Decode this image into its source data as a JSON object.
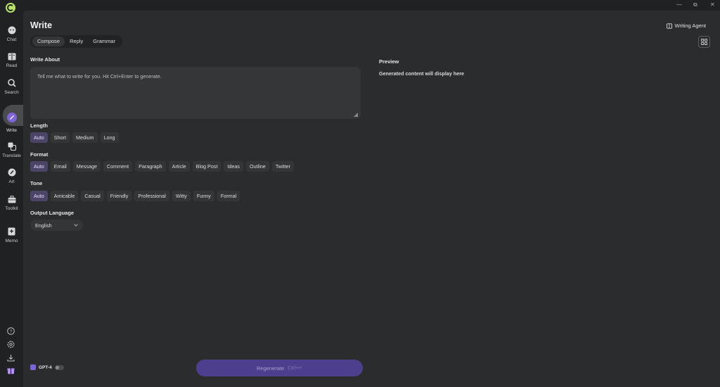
{
  "sidebar": {
    "items": [
      {
        "label": "Chat",
        "icon": "chat-icon"
      },
      {
        "label": "Read",
        "icon": "book-icon"
      },
      {
        "label": "Search",
        "icon": "search-icon"
      },
      {
        "label": "Write",
        "icon": "pen-icon",
        "active": true
      },
      {
        "label": "Translate",
        "icon": "translate-icon"
      },
      {
        "label": "Art",
        "icon": "brush-icon"
      },
      {
        "label": "Toolkit",
        "icon": "toolbox-icon"
      },
      {
        "label": "Memo",
        "icon": "memo-icon"
      }
    ],
    "bottom_icons": [
      "help-icon",
      "settings-icon",
      "download-icon",
      "gift-icon"
    ]
  },
  "header": {
    "title": "Write",
    "tabs": [
      {
        "label": "Compose",
        "active": true
      },
      {
        "label": "Reply"
      },
      {
        "label": "Grammar"
      }
    ],
    "agent_label": "Writing Agent"
  },
  "compose": {
    "write_about_label": "Write About",
    "textarea_placeholder": "Tell me what to write for you. Hit Ctrl+Enter to generate.",
    "length": {
      "label": "Length",
      "options": [
        "Auto",
        "Short",
        "Medium",
        "Long"
      ],
      "selected": "Auto"
    },
    "format": {
      "label": "Format",
      "options": [
        "Auto",
        "Email",
        "Message",
        "Comment",
        "Paragraph",
        "Article",
        "Blog Post",
        "Ideas",
        "Outline",
        "Twitter"
      ],
      "selected": "Auto"
    },
    "tone": {
      "label": "Tone",
      "options": [
        "Auto",
        "Amicable",
        "Casual",
        "Friendly",
        "Professional",
        "Witty",
        "Funny",
        "Formal"
      ],
      "selected": "Auto"
    },
    "output_language": {
      "label": "Output Language",
      "value": "English"
    }
  },
  "preview": {
    "title": "Preview",
    "placeholder": "Generated content will display here"
  },
  "footer": {
    "model_label": "GPT-4",
    "regenerate_label": "Regenerate",
    "regenerate_hint": "Ctrl+↵"
  },
  "colors": {
    "accent": "#7d64d8",
    "selected_chip": "#4d4568",
    "button": "#4e3f8e",
    "logo": "#b7e36a"
  }
}
